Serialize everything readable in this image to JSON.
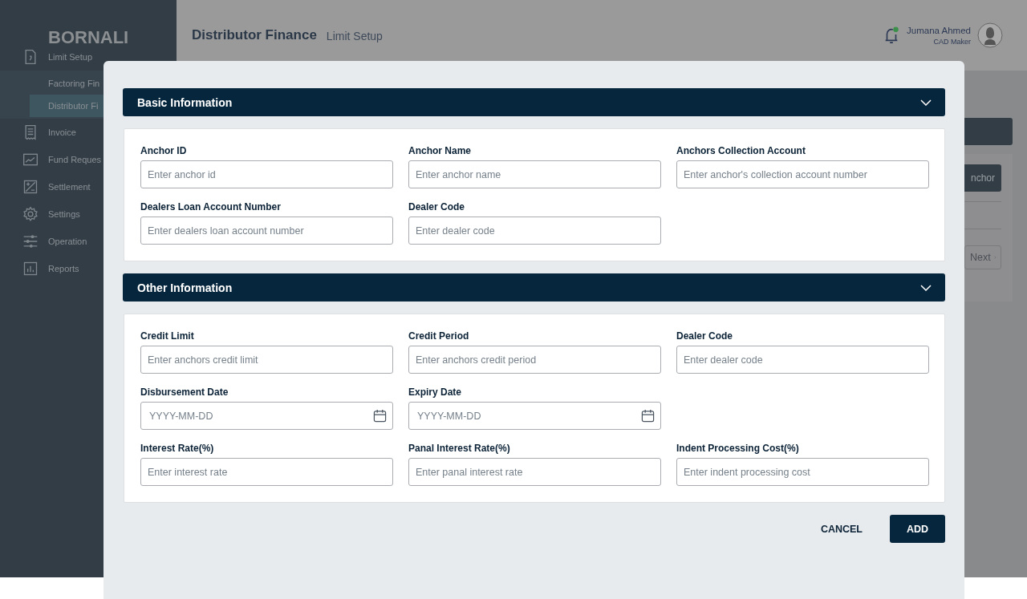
{
  "sidebar": {
    "logo": "BORNALI",
    "items": [
      {
        "label": "Limit Setup",
        "children": [
          {
            "label": "Factoring Fin",
            "selected": false
          },
          {
            "label": "Distributor Fi",
            "selected": true
          }
        ]
      },
      {
        "label": "Invoice"
      },
      {
        "label": "Fund Reques"
      },
      {
        "label": "Settlement"
      },
      {
        "label": "Settings"
      },
      {
        "label": "Operation"
      },
      {
        "label": "Reports"
      }
    ]
  },
  "header": {
    "title": "Distributor Finance",
    "subtitle": "Limit Setup",
    "notification_unread": true,
    "user": {
      "name": "Jumana Ahmed",
      "role": "CAD Maker"
    }
  },
  "background": {
    "button": "nchor",
    "next": "Next"
  },
  "modal": {
    "sections": [
      {
        "title": "Basic Information",
        "expanded": true,
        "rows": [
          [
            {
              "label": "Anchor ID",
              "placeholder": "Enter anchor id",
              "kind": "text"
            },
            {
              "label": "Anchor Name",
              "placeholder": "Enter anchor name",
              "kind": "text"
            },
            {
              "label": "Anchors Collection Account",
              "placeholder": "Enter anchor's collection account number",
              "kind": "text"
            }
          ],
          [
            {
              "label": "Dealers Loan Account Number",
              "placeholder": "Enter dealers loan account number",
              "kind": "text"
            },
            {
              "label": "Dealer Code",
              "placeholder": "Enter dealer code",
              "kind": "text"
            }
          ]
        ]
      },
      {
        "title": "Other Information",
        "expanded": true,
        "rows": [
          [
            {
              "label": "Credit Limit",
              "placeholder": "Enter anchors credit limit",
              "kind": "text"
            },
            {
              "label": "Credit Period",
              "placeholder": "Enter anchors credit period",
              "kind": "text"
            },
            {
              "label": "Dealer Code",
              "placeholder": "Enter dealer code",
              "kind": "text"
            }
          ],
          [
            {
              "label": "Disbursement Date",
              "placeholder": "YYYY-MM-DD",
              "kind": "date"
            },
            {
              "label": "Expiry Date",
              "placeholder": "YYYY-MM-DD",
              "kind": "date"
            }
          ],
          [
            {
              "label": "Interest Rate(%)",
              "placeholder": "Enter interest rate",
              "kind": "text"
            },
            {
              "label": "Panal Interest Rate(%)",
              "placeholder": "Enter panal interest rate",
              "kind": "text"
            },
            {
              "label": "Indent Processing Cost(%)",
              "placeholder": "Enter indent processing cost",
              "kind": "text"
            }
          ]
        ]
      }
    ],
    "buttons": {
      "cancel": "CANCEL",
      "add": "ADD"
    }
  }
}
